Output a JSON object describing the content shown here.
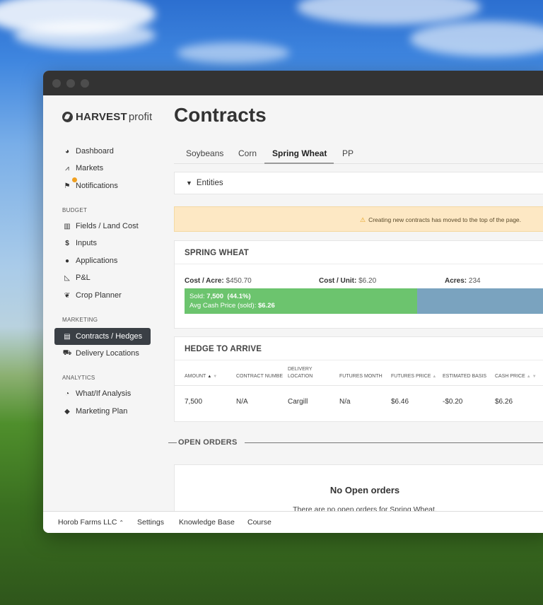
{
  "app": {
    "logo_text_bold": "HARVEST",
    "logo_text_light": "profit"
  },
  "sidebar": {
    "items": [
      {
        "label": "Dashboard",
        "icon": "dashboard-icon"
      },
      {
        "label": "Markets",
        "icon": "chart-line-icon"
      },
      {
        "label": "Notifications",
        "icon": "flag-icon"
      }
    ],
    "budget_heading": "BUDGET",
    "budget_items": [
      {
        "label": "Fields / Land Cost",
        "icon": "map-icon"
      },
      {
        "label": "Inputs",
        "icon": "dollar-icon"
      },
      {
        "label": "Applications",
        "icon": "droplet-icon"
      },
      {
        "label": "P&L",
        "icon": "chart-area-icon"
      },
      {
        "label": "Crop Planner",
        "icon": "leaf-icon"
      }
    ],
    "marketing_heading": "MARKETING",
    "marketing_items": [
      {
        "label": "Contracts / Hedges",
        "icon": "file-icon",
        "active": true
      },
      {
        "label": "Delivery Locations",
        "icon": "truck-icon"
      }
    ],
    "analytics_heading": "ANALYTICS",
    "analytics_items": [
      {
        "label": "What/If Analysis",
        "icon": "pie-chart-icon"
      },
      {
        "label": "Marketing Plan",
        "icon": "tags-icon"
      }
    ]
  },
  "main": {
    "title": "Contracts",
    "tabs": [
      {
        "label": "Soybeans"
      },
      {
        "label": "Corn"
      },
      {
        "label": "Spring Wheat",
        "active": true
      },
      {
        "label": "PP"
      }
    ],
    "entities_label": "Entities",
    "alert_text": "Creating new contracts has moved to the top of the page.",
    "spring_wheat": {
      "title": "SPRING WHEAT",
      "cost_acre_label": "Cost / Acre:",
      "cost_acre_value": "$450.70",
      "cost_unit_label": "Cost / Unit:",
      "cost_unit_value": "$6.20",
      "acres_label": "Acres:",
      "acres_value": "234",
      "sold_label": "Sold:",
      "sold_value": "7,500  (44.1%)",
      "sold_fraction": 0.626,
      "avg_cash_label": "Avg Cash Price (sold):",
      "avg_cash_value": "$6.26"
    },
    "hedge_to_arrive": {
      "title": "HEDGE TO ARRIVE",
      "columns": {
        "amount": "AMOUNT",
        "contract_number": "CONTRACT NUMBE",
        "delivery_line1": "DELIVERY",
        "delivery_line2": "LOCATION",
        "futures_month": "FUTURES MONTH",
        "futures_price": "FUTURES PRICE",
        "estimated_basis": "ESTIMATED BASIS",
        "cash_price": "CASH PRICE"
      },
      "row": {
        "amount": "7,500",
        "contract_number": "N/A",
        "delivery_location": "Cargill",
        "futures_month": "N/a",
        "futures_price": "$6.46",
        "estimated_basis": "-$0.20",
        "cash_price": "$6.26"
      }
    },
    "open_orders": {
      "heading": "OPEN ORDERS",
      "empty_title": "No Open orders",
      "empty_subtitle": "There are no open orders for Spring Wheat."
    }
  },
  "footer": {
    "farm": "Horob Farms LLC",
    "settings": "Settings",
    "knowledge_base": "Knowledge Base",
    "course": "Course"
  },
  "colors": {
    "sold_green": "#6cc46e",
    "remaining_blue": "#7aa3bf",
    "alert_bg": "#fde8c4",
    "active_nav": "#3a3f45"
  }
}
